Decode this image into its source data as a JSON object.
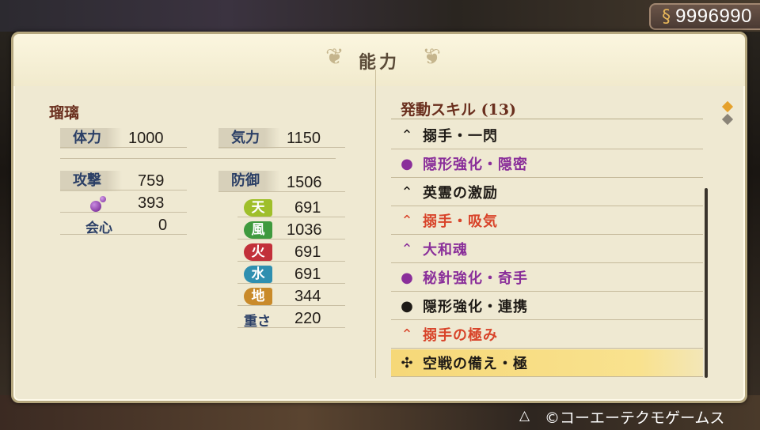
{
  "money": {
    "icon": "coin-icon",
    "value": "9996990"
  },
  "title": "能力",
  "character": {
    "name": "瑠璃"
  },
  "stats": {
    "hp_label": "体力",
    "hp": "1000",
    "ki_label": "気力",
    "ki": "1150",
    "atk_label": "攻撃",
    "atk": "759",
    "def_label": "防御",
    "def": "1506",
    "magic": "393",
    "crit_label": "会心",
    "crit": "0",
    "weight_label": "重さ",
    "weight": "220"
  },
  "elements": [
    {
      "label": "天",
      "value": "691",
      "color": "#9fbf2a"
    },
    {
      "label": "風",
      "value": "1036",
      "color": "#3f9a3e"
    },
    {
      "label": "火",
      "value": "691",
      "color": "#c2303a"
    },
    {
      "label": "水",
      "value": "691",
      "color": "#2f8fb0"
    },
    {
      "label": "地",
      "value": "344",
      "color": "#c98a2a"
    }
  ],
  "skills_header": "発動スキル (13)",
  "skills": [
    {
      "icon": "mountain-icon",
      "glyph": "⌃",
      "label": "搦手・一閃",
      "color": "#1e1a16"
    },
    {
      "icon": "purple-orb-icon",
      "glyph": "●",
      "label": "隠形強化・隠密",
      "color": "#8a2f9a"
    },
    {
      "icon": "mountain-icon",
      "glyph": "⌃",
      "label": "英霊の激励",
      "color": "#1e1a16"
    },
    {
      "icon": "mountain-icon",
      "glyph": "⌃",
      "label": "搦手・吸気",
      "color": "#d8442a"
    },
    {
      "icon": "mountain-icon",
      "glyph": "⌃",
      "label": "大和魂",
      "color": "#8a2f9a"
    },
    {
      "icon": "purple-orb-icon",
      "glyph": "●",
      "label": "秘針強化・奇手",
      "color": "#8a2f9a"
    },
    {
      "icon": "dark-orb-icon",
      "glyph": "●",
      "label": "隠形強化・連携",
      "color": "#1e1a16"
    },
    {
      "icon": "mountain-icon",
      "glyph": "⌃",
      "label": "搦手の極み",
      "color": "#d8442a"
    },
    {
      "icon": "tomoe-icon",
      "glyph": "✣",
      "label": "空戦の備え・極",
      "color": "#1e1a16",
      "selected": true
    }
  ],
  "footer": {
    "button": "△",
    "copyright": "©コーエーテクモゲームス"
  }
}
